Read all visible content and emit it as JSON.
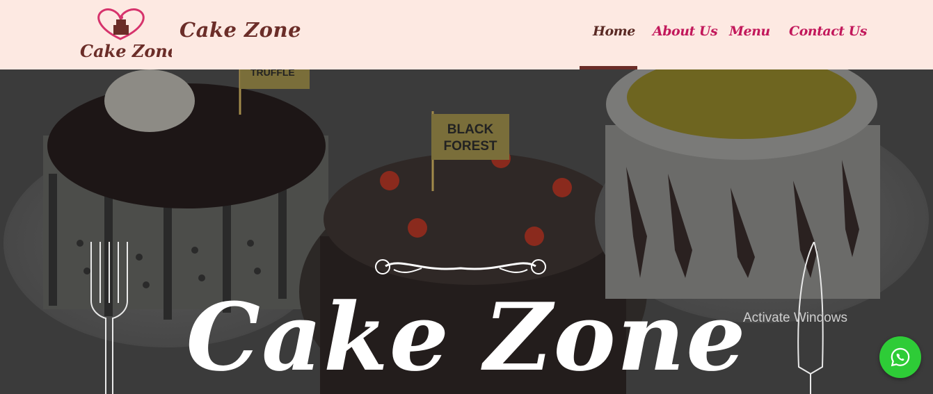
{
  "header": {
    "logo_alt": "Cake Zone",
    "brand": "Cake Zone",
    "nav": [
      {
        "label": "Home",
        "active": true
      },
      {
        "label": "About Us",
        "active": false
      },
      {
        "label": "Menu",
        "active": false
      },
      {
        "label": "Contact Us",
        "active": false
      }
    ]
  },
  "hero": {
    "title": "Cake Zone",
    "cake_tags": [
      "TRUFFLE",
      "BLACK FOREST"
    ]
  },
  "overlay": {
    "activate_windows": "Activate Windows"
  },
  "floating": {
    "whatsapp_icon": "whatsapp-icon"
  },
  "colors": {
    "header_bg": "#fde9e2",
    "brand": "#6b2d28",
    "nav_link": "#c2185b",
    "whatsapp": "#2ecc37"
  }
}
